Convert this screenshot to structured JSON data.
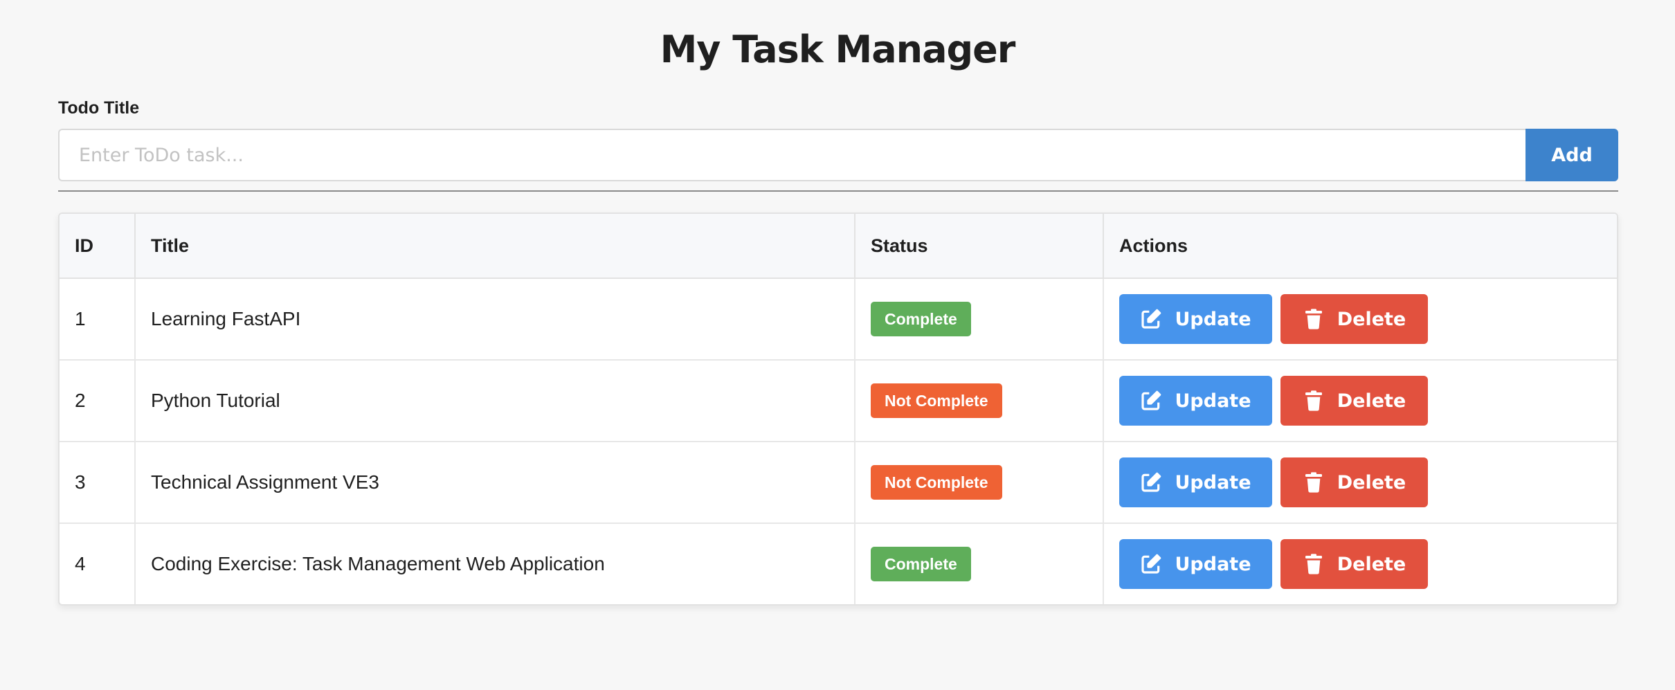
{
  "header": {
    "title": "My Task Manager"
  },
  "form": {
    "label": "Todo Title",
    "placeholder": "Enter ToDo task...",
    "value": "",
    "add_label": "Add"
  },
  "table": {
    "columns": [
      "ID",
      "Title",
      "Status",
      "Actions"
    ],
    "rows": [
      {
        "id": "1",
        "title": "Learning FastAPI",
        "status": "Complete",
        "update_label": "Update",
        "delete_label": "Delete"
      },
      {
        "id": "2",
        "title": "Python Tutorial",
        "status": "Not Complete",
        "update_label": "Update",
        "delete_label": "Delete"
      },
      {
        "id": "3",
        "title": "Technical Assignment VE3",
        "status": "Not Complete",
        "update_label": "Update",
        "delete_label": "Delete"
      },
      {
        "id": "4",
        "title": "Coding Exercise: Task Management Web Application",
        "status": "Complete",
        "update_label": "Update",
        "delete_label": "Delete"
      }
    ]
  },
  "icons": {
    "update": "edit-icon",
    "delete": "trash-icon"
  },
  "colors": {
    "background": "#f7f7f7",
    "add_button": "#3d83cc",
    "update_button": "#4794ec",
    "delete_button": "#e2513e",
    "complete_badge": "#5fae5a",
    "not_complete_badge": "#ef6234"
  }
}
